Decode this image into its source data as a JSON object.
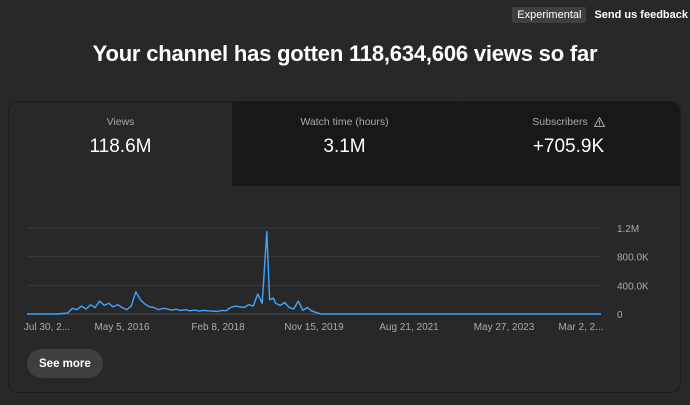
{
  "topbar": {
    "experimental_label": "Experimental",
    "feedback_label": "Send us feedback"
  },
  "headline": "Your channel has gotten 118,634,606 views so far",
  "tabs": [
    {
      "label": "Views",
      "value": "118.6M",
      "active": true
    },
    {
      "label": "Watch time (hours)",
      "value": "3.1M",
      "active": false
    },
    {
      "label": "Subscribers",
      "value": "+705.9K",
      "active": false,
      "icon": "warning-icon"
    }
  ],
  "see_more_label": "See more",
  "colors": {
    "line": "#3ea6ff",
    "background": "#282828",
    "card": "#212121"
  },
  "chart_data": {
    "type": "line",
    "x_tick_labels": [
      "Jul 30, 2...",
      "May 5, 2016",
      "Feb 8, 2018",
      "Nov 15, 2019",
      "Aug 21, 2021",
      "May 27, 2023",
      "Mar 2, 2..."
    ],
    "y_tick_labels": [
      "1.2M",
      "800.0K",
      "400.0K",
      "0"
    ],
    "ylim": [
      0,
      1200000
    ],
    "grid": true,
    "series": [
      {
        "points": [
          {
            "x": "2014-07-30",
            "y": 0
          },
          {
            "x": "2015-03-01",
            "y": 0
          },
          {
            "x": "2015-05-01",
            "y": 15000
          },
          {
            "x": "2015-06-01",
            "y": 80000
          },
          {
            "x": "2015-07-01",
            "y": 60000
          },
          {
            "x": "2015-08-01",
            "y": 110000
          },
          {
            "x": "2015-09-01",
            "y": 70000
          },
          {
            "x": "2015-10-01",
            "y": 130000
          },
          {
            "x": "2015-11-01",
            "y": 90000
          },
          {
            "x": "2015-12-01",
            "y": 180000
          },
          {
            "x": "2016-01-01",
            "y": 120000
          },
          {
            "x": "2016-02-01",
            "y": 150000
          },
          {
            "x": "2016-03-01",
            "y": 100000
          },
          {
            "x": "2016-04-01",
            "y": 130000
          },
          {
            "x": "2016-05-01",
            "y": 90000
          },
          {
            "x": "2016-06-01",
            "y": 60000
          },
          {
            "x": "2016-07-01",
            "y": 110000
          },
          {
            "x": "2016-08-01",
            "y": 310000
          },
          {
            "x": "2016-09-01",
            "y": 200000
          },
          {
            "x": "2016-10-01",
            "y": 140000
          },
          {
            "x": "2016-11-01",
            "y": 100000
          },
          {
            "x": "2016-12-01",
            "y": 90000
          },
          {
            "x": "2017-01-01",
            "y": 60000
          },
          {
            "x": "2017-02-01",
            "y": 80000
          },
          {
            "x": "2017-03-01",
            "y": 70000
          },
          {
            "x": "2017-04-01",
            "y": 55000
          },
          {
            "x": "2017-05-01",
            "y": 65000
          },
          {
            "x": "2017-06-01",
            "y": 50000
          },
          {
            "x": "2017-07-01",
            "y": 60000
          },
          {
            "x": "2017-08-01",
            "y": 45000
          },
          {
            "x": "2017-09-01",
            "y": 55000
          },
          {
            "x": "2017-10-01",
            "y": 40000
          },
          {
            "x": "2017-11-01",
            "y": 50000
          },
          {
            "x": "2017-12-01",
            "y": 45000
          },
          {
            "x": "2018-01-01",
            "y": 40000
          },
          {
            "x": "2018-02-01",
            "y": 35000
          },
          {
            "x": "2018-03-01",
            "y": 50000
          },
          {
            "x": "2018-04-01",
            "y": 45000
          },
          {
            "x": "2018-05-01",
            "y": 90000
          },
          {
            "x": "2018-06-01",
            "y": 110000
          },
          {
            "x": "2018-07-01",
            "y": 100000
          },
          {
            "x": "2018-08-01",
            "y": 90000
          },
          {
            "x": "2018-09-01",
            "y": 130000
          },
          {
            "x": "2018-10-01",
            "y": 110000
          },
          {
            "x": "2018-11-01",
            "y": 280000
          },
          {
            "x": "2018-12-01",
            "y": 150000
          },
          {
            "x": "2019-01-01",
            "y": 1150000
          },
          {
            "x": "2019-01-20",
            "y": 200000
          },
          {
            "x": "2019-02-15",
            "y": 220000
          },
          {
            "x": "2019-03-01",
            "y": 150000
          },
          {
            "x": "2019-04-01",
            "y": 120000
          },
          {
            "x": "2019-05-01",
            "y": 160000
          },
          {
            "x": "2019-06-01",
            "y": 90000
          },
          {
            "x": "2019-07-01",
            "y": 70000
          },
          {
            "x": "2019-08-01",
            "y": 180000
          },
          {
            "x": "2019-09-01",
            "y": 50000
          },
          {
            "x": "2019-10-01",
            "y": 90000
          },
          {
            "x": "2019-11-01",
            "y": 40000
          },
          {
            "x": "2019-12-01",
            "y": 20000
          },
          {
            "x": "2020-01-01",
            "y": 0
          },
          {
            "x": "2025-03-02",
            "y": 0
          }
        ]
      }
    ]
  }
}
